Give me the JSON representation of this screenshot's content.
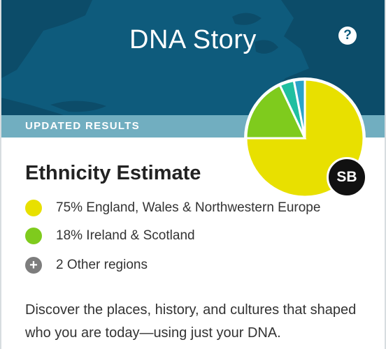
{
  "header": {
    "title": "DNA Story",
    "help_icon": "question-circle-icon",
    "banner": "UPDATED RESULTS"
  },
  "ethnicity": {
    "title": "Ethnicity Estimate",
    "regions": [
      {
        "label": "75% England, Wales & Northwestern Europe",
        "percent": 75,
        "color": "#e8e000"
      },
      {
        "label": "18% Ireland & Scotland",
        "percent": 18,
        "color": "#7fcb1d"
      },
      {
        "label": "2 Other regions",
        "icon": "plus-circle-icon"
      }
    ],
    "other_slices": [
      {
        "percent": 4,
        "color": "#1fbfa0"
      },
      {
        "percent": 3,
        "color": "#2aa3c8"
      }
    ]
  },
  "avatar": {
    "initials": "SB"
  },
  "description": "Discover the places, history, and cultures that shaped who you are today—using just your DNA.",
  "colors": {
    "header_bg": "#0e5b7c",
    "banner_bg": "#71aec0",
    "land": "#0c4c69"
  }
}
